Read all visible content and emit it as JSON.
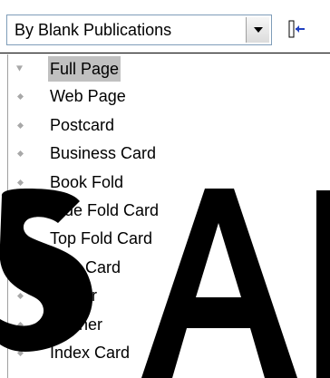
{
  "toolbar": {
    "combo_value": "By Blank Publications",
    "dropdown_icon": "chevron-down-icon",
    "toggle_icon": "collapse-panel-icon"
  },
  "size_list": {
    "items": [
      {
        "label": "Full Page",
        "selected": true
      },
      {
        "label": "Web Page",
        "selected": false
      },
      {
        "label": "Postcard",
        "selected": false
      },
      {
        "label": "Business Card",
        "selected": false
      },
      {
        "label": "Book Fold",
        "selected": false
      },
      {
        "label": "Side Fold Card",
        "selected": false
      },
      {
        "label": "Top Fold Card",
        "selected": false
      },
      {
        "label": "Tent Card",
        "selected": false
      },
      {
        "label": "Poster",
        "selected": false
      },
      {
        "label": "Banner",
        "selected": false
      },
      {
        "label": "Index Card",
        "selected": false
      }
    ]
  },
  "colors": {
    "selection_bg": "#c0c0c0",
    "combo_border": "#7f9db9",
    "bullet": "#a8a8a8",
    "watermark": "#000000",
    "toggle_accent": "#2040c0"
  }
}
